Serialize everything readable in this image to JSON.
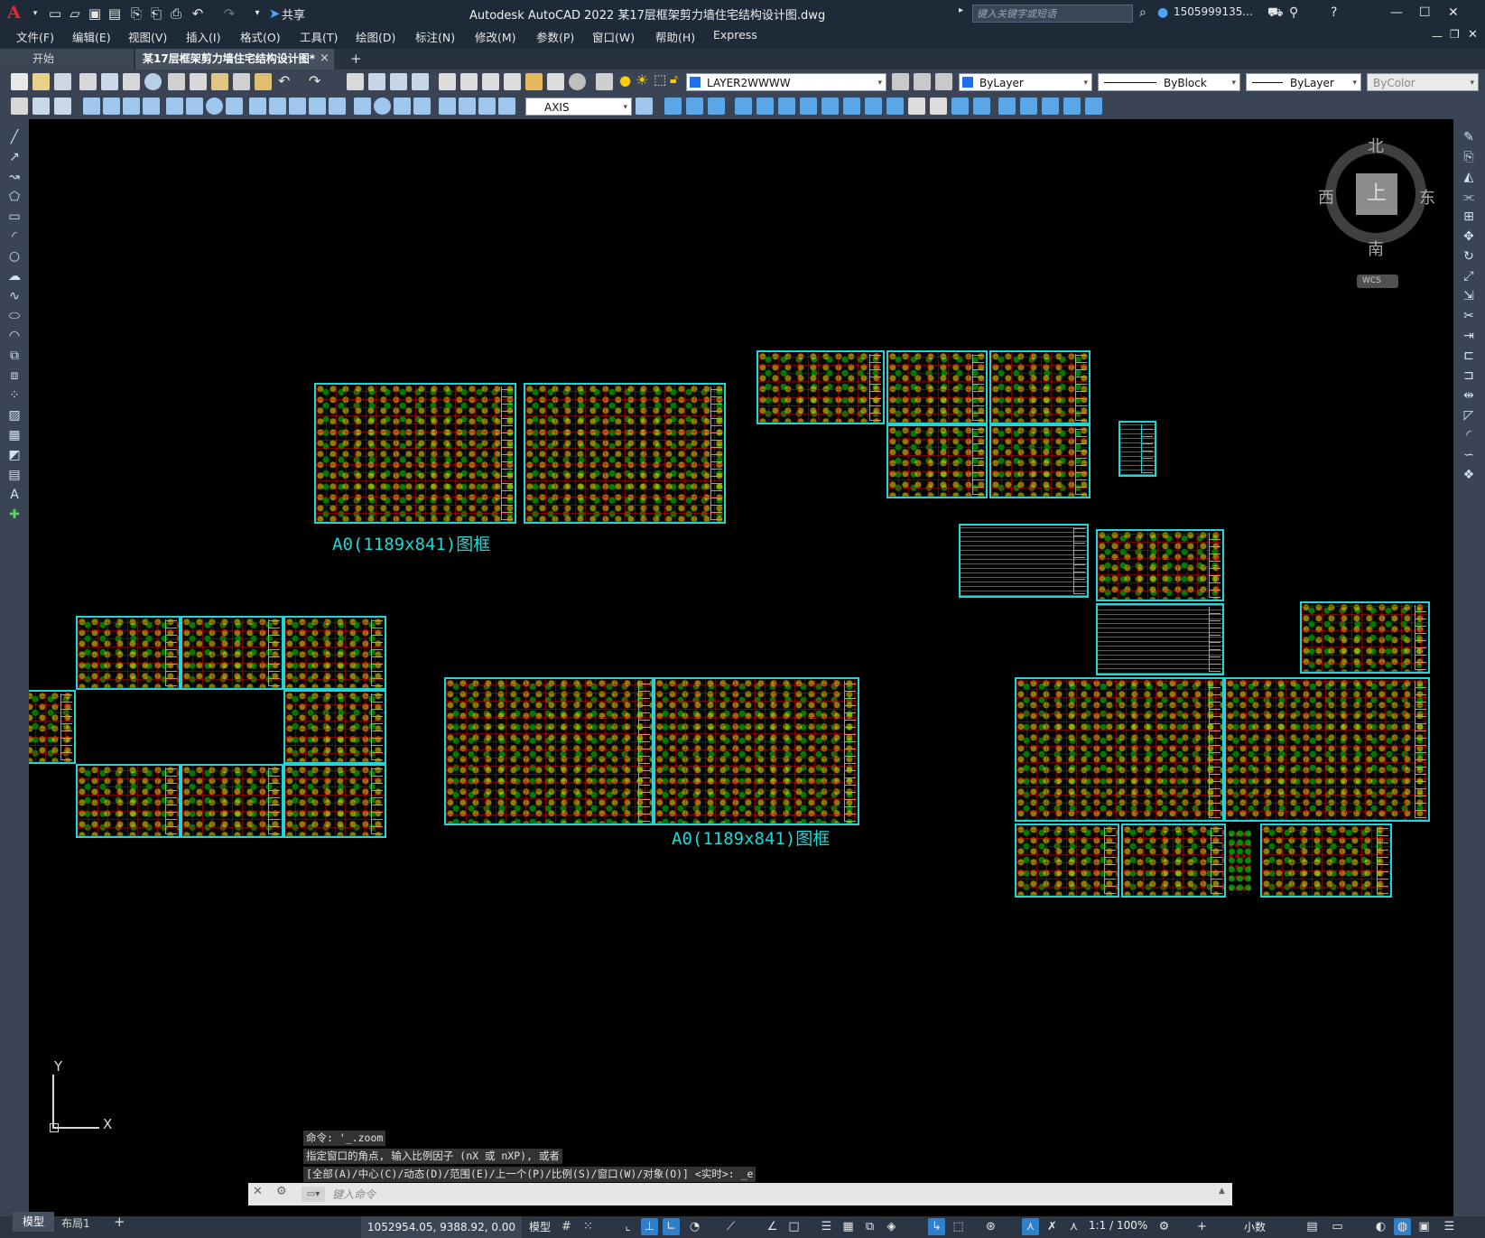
{
  "app": {
    "logo": "A",
    "share_label": "共享",
    "window_title": "Autodesk AutoCAD 2022    某17层框架剪力墙住宅结构设计图.dwg",
    "search_placeholder": "键入关键字或短语",
    "user": "1505999135...",
    "window_controls": [
      "minimize-icon",
      "maximize-icon",
      "close-icon"
    ]
  },
  "menu": [
    "文件(F)",
    "编辑(E)",
    "视图(V)",
    "插入(I)",
    "格式(O)",
    "工具(T)",
    "绘图(D)",
    "标注(N)",
    "修改(M)",
    "参数(P)",
    "窗口(W)",
    "帮助(H)",
    "Express"
  ],
  "tabs": {
    "start": "开始",
    "document": "某17层框架剪力墙住宅结构设计图*",
    "close": "×",
    "new": "+"
  },
  "toolbar": {
    "layer_name": "LAYER2WWWW",
    "color_value": "ByLayer",
    "linetype_value": "ByBlock",
    "lineweight_value": "ByLayer",
    "plotstyle_value": "ByColor",
    "dimstyle_value": "AXIS"
  },
  "drawing": {
    "frame_labels": [
      "A0(1189x841)图框",
      "A0(1189x841)图框"
    ]
  },
  "viewcube": {
    "north": "北",
    "south": "南",
    "east": "东",
    "west": "西",
    "top": "上",
    "wcs": "WCS"
  },
  "ucs": {
    "x": "X",
    "y": "Y"
  },
  "command": {
    "history": [
      "命令: '_.zoom",
      "指定窗口的角点, 输入比例因子 (nX 或 nXP), 或者",
      "[全部(A)/中心(C)/动态(D)/范围(E)/上一个(P)/比例(S)/窗口(W)/对象(O)] <实时>: _e"
    ],
    "placeholder": "键入命令"
  },
  "status": {
    "tab_model": "模型",
    "tab_layout": "布局1",
    "coordinates": "1052954.05, 9388.92, 0.00",
    "space": "模型",
    "scale": "1:1 / 100%",
    "units": "小数"
  },
  "colors": {
    "frame": "#1fd6d6",
    "grid": "#c80000",
    "background": "#000000",
    "chrome": "#3b4454"
  }
}
